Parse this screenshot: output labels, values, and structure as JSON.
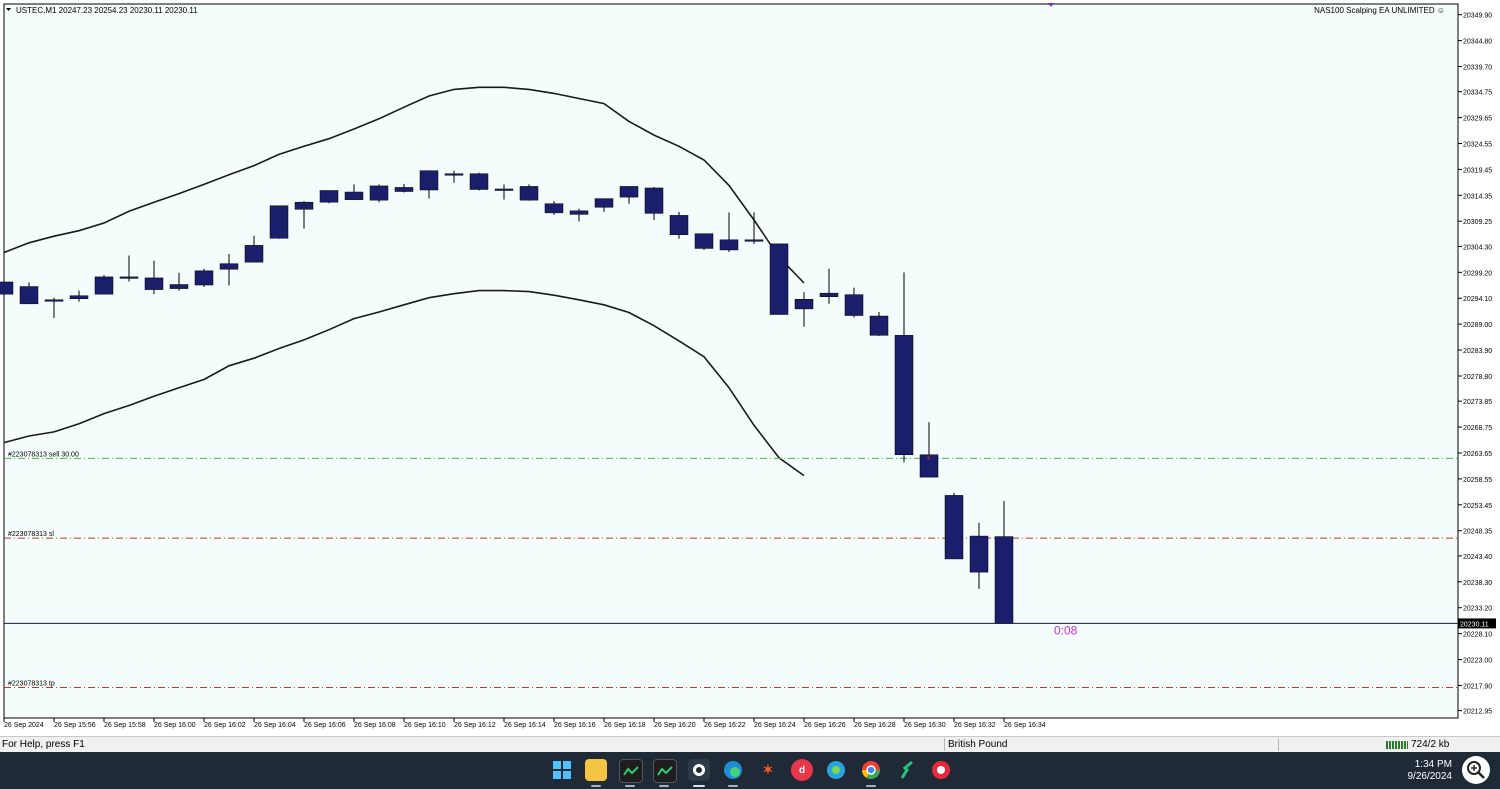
{
  "chart_data": {
    "type": "candlestick",
    "symbol_header": "USTEC,M1  20247.23 20254.23 20230.11 20230.11",
    "ea_label": "NAS100 Scalping EA UNLIMITED ☺",
    "y_ticks": [
      "20349.90",
      "20344.80",
      "20339.70",
      "20334.75",
      "20329.65",
      "20324.55",
      "20319.45",
      "20314.35",
      "20309.25",
      "20304.30",
      "20299.20",
      "20294.10",
      "20289.00",
      "20283.90",
      "20278.80",
      "20273.85",
      "20268.75",
      "20263.65",
      "20258.55",
      "20253.45",
      "20248.35",
      "20243.40",
      "20238.30",
      "20233.20",
      "20228.10",
      "20223.00",
      "20217.90",
      "20212.95"
    ],
    "x_ticks": [
      "26 Sep 2024",
      "26 Sep 15:56",
      "26 Sep 15:58",
      "26 Sep 16:00",
      "26 Sep 16:02",
      "26 Sep 16:04",
      "26 Sep 16:06",
      "26 Sep 16:08",
      "26 Sep 16:10",
      "26 Sep 16:12",
      "26 Sep 16:14",
      "26 Sep 16:16",
      "26 Sep 16:18",
      "26 Sep 16:20",
      "26 Sep 16:22",
      "26 Sep 16:24",
      "26 Sep 16:26",
      "26 Sep 16:28",
      "26 Sep 16:30",
      "26 Sep 16:32",
      "26 Sep 16:34"
    ],
    "ylim": [
      20211.5,
      20352.0
    ],
    "candles": [
      {
        "o": 20294.9,
        "h": 20297.2,
        "l": 20287.8,
        "c": 20297.3
      },
      {
        "o": 20293.0,
        "h": 20297.2,
        "l": 20293.0,
        "c": 20296.4
      },
      {
        "o": 20293.6,
        "h": 20294.2,
        "l": 20290.2,
        "c": 20293.8
      },
      {
        "o": 20294.0,
        "h": 20295.6,
        "l": 20293.4,
        "c": 20294.6
      },
      {
        "o": 20294.9,
        "h": 20298.7,
        "l": 20294.8,
        "c": 20298.3
      },
      {
        "o": 20298.2,
        "h": 20302.5,
        "l": 20297.4,
        "c": 20298.3
      },
      {
        "o": 20298.1,
        "h": 20301.5,
        "l": 20294.9,
        "c": 20295.8
      },
      {
        "o": 20296.0,
        "h": 20299.1,
        "l": 20295.6,
        "c": 20296.8
      },
      {
        "o": 20296.7,
        "h": 20299.9,
        "l": 20296.3,
        "c": 20299.5
      },
      {
        "o": 20299.8,
        "h": 20302.8,
        "l": 20296.6,
        "c": 20300.9
      },
      {
        "o": 20301.2,
        "h": 20306.4,
        "l": 20301.1,
        "c": 20304.5
      },
      {
        "o": 20305.9,
        "h": 20312.3,
        "l": 20305.8,
        "c": 20312.3
      },
      {
        "o": 20311.6,
        "h": 20313.2,
        "l": 20307.8,
        "c": 20313.0
      },
      {
        "o": 20313.0,
        "h": 20315.3,
        "l": 20312.8,
        "c": 20315.3
      },
      {
        "o": 20313.5,
        "h": 20316.5,
        "l": 20313.4,
        "c": 20315.0
      },
      {
        "o": 20313.4,
        "h": 20316.5,
        "l": 20313.0,
        "c": 20316.2
      },
      {
        "o": 20315.1,
        "h": 20316.6,
        "l": 20314.9,
        "c": 20315.9
      },
      {
        "o": 20315.4,
        "h": 20319.2,
        "l": 20313.7,
        "c": 20319.2
      },
      {
        "o": 20318.5,
        "h": 20319.2,
        "l": 20316.8,
        "c": 20318.6
      },
      {
        "o": 20315.5,
        "h": 20318.8,
        "l": 20315.3,
        "c": 20318.6
      },
      {
        "o": 20315.6,
        "h": 20316.5,
        "l": 20313.5,
        "c": 20315.5
      },
      {
        "o": 20313.4,
        "h": 20316.5,
        "l": 20313.3,
        "c": 20316.1
      },
      {
        "o": 20312.7,
        "h": 20313.2,
        "l": 20310.5,
        "c": 20310.9
      },
      {
        "o": 20311.3,
        "h": 20311.7,
        "l": 20309.2,
        "c": 20310.6
      },
      {
        "o": 20312.0,
        "h": 20313.6,
        "l": 20311.1,
        "c": 20313.7
      },
      {
        "o": 20314.0,
        "h": 20316.0,
        "l": 20312.7,
        "c": 20316.1
      },
      {
        "o": 20315.8,
        "h": 20316.0,
        "l": 20309.5,
        "c": 20310.8
      },
      {
        "o": 20310.4,
        "h": 20311.1,
        "l": 20305.8,
        "c": 20306.6
      },
      {
        "o": 20306.8,
        "h": 20306.9,
        "l": 20303.6,
        "c": 20303.9
      },
      {
        "o": 20305.6,
        "h": 20311.0,
        "l": 20303.2,
        "c": 20303.6
      },
      {
        "o": 20305.6,
        "h": 20311.0,
        "l": 20304.8,
        "c": 20305.6
      },
      {
        "o": 20304.8,
        "h": 20304.8,
        "l": 20290.9,
        "c": 20290.9
      },
      {
        "o": 20293.9,
        "h": 20295.3,
        "l": 20288.5,
        "c": 20292.0
      },
      {
        "o": 20294.4,
        "h": 20299.9,
        "l": 20293.0,
        "c": 20295.1
      },
      {
        "o": 20294.8,
        "h": 20296.2,
        "l": 20290.3,
        "c": 20290.7
      },
      {
        "o": 20290.6,
        "h": 20291.4,
        "l": 20286.7,
        "c": 20286.8
      },
      {
        "o": 20286.8,
        "h": 20299.2,
        "l": 20261.8,
        "c": 20263.3
      },
      {
        "o": 20263.3,
        "h": 20269.7,
        "l": 20260.7,
        "c": 20258.9
      },
      {
        "o": 20255.3,
        "h": 20255.8,
        "l": 20247.1,
        "c": 20242.8
      },
      {
        "o": 20247.3,
        "h": 20249.9,
        "l": 20236.9,
        "c": 20240.2
      },
      {
        "o": 20247.2,
        "h": 20254.2,
        "l": 20230.1,
        "c": 20230.1
      }
    ],
    "bands": {
      "upper": [
        20303.1,
        20305.0,
        20306.3,
        20307.4,
        20308.9,
        20311.2,
        20313.0,
        20314.7,
        20316.5,
        20318.4,
        20320.2,
        20322.4,
        20324.0,
        20325.5,
        20327.4,
        20329.4,
        20331.7,
        20333.9,
        20335.2,
        20335.6,
        20335.6,
        20335.2,
        20334.4,
        20333.4,
        20332.4,
        20328.9,
        20326.2,
        20324.0,
        20321.3,
        20316.3,
        20309.5,
        20302.2,
        20297.1
      ],
      "lower": [
        20265.7,
        20267.0,
        20267.8,
        20269.4,
        20271.4,
        20273.0,
        20274.8,
        20276.5,
        20278.1,
        20280.8,
        20282.3,
        20284.2,
        20285.9,
        20287.9,
        20290.1,
        20291.4,
        20292.8,
        20294.2,
        20295.0,
        20295.6,
        20295.6,
        20295.4,
        20294.7,
        20293.8,
        20292.8,
        20291.3,
        20288.7,
        20285.7,
        20282.6,
        20276.5,
        20269.1,
        20262.7,
        20259.2
      ]
    },
    "current_price": "20230.11",
    "countdown": "0:08",
    "lines": [
      {
        "label": "#223078313 sell 30.00",
        "price": 20262.6,
        "color": "#4caf50"
      },
      {
        "label": "#223078313 sl",
        "price": 20246.9,
        "color": "#c0392b"
      },
      {
        "label": "#223078313 tp",
        "price": 20217.5,
        "color": "#c0392b"
      }
    ],
    "colors": {
      "background": "#f4fdfb",
      "candle_bull": "#1a1e6b",
      "candle_bear": "#1a1e6b",
      "band": "#1a1a1a",
      "axis": "#000000",
      "countdown": "#cc33cc",
      "marker": "#7b2bd1"
    },
    "grid": false
  },
  "statusbar": {
    "help": "For Help, press F1",
    "profile": "British Pound",
    "traffic": "724/2 kb"
  },
  "taskbar": {
    "time": "1:34 PM",
    "date": "9/26/2024",
    "icons": [
      "windows-start-icon",
      "file-explorer-icon",
      "metatrader-icon",
      "metatrader-icon-2",
      "app-icon",
      "edge-icon",
      "app-icon-2",
      "app-icon-3",
      "app-icon-4",
      "chrome-icon",
      "app-icon-5",
      "app-icon-6"
    ]
  }
}
